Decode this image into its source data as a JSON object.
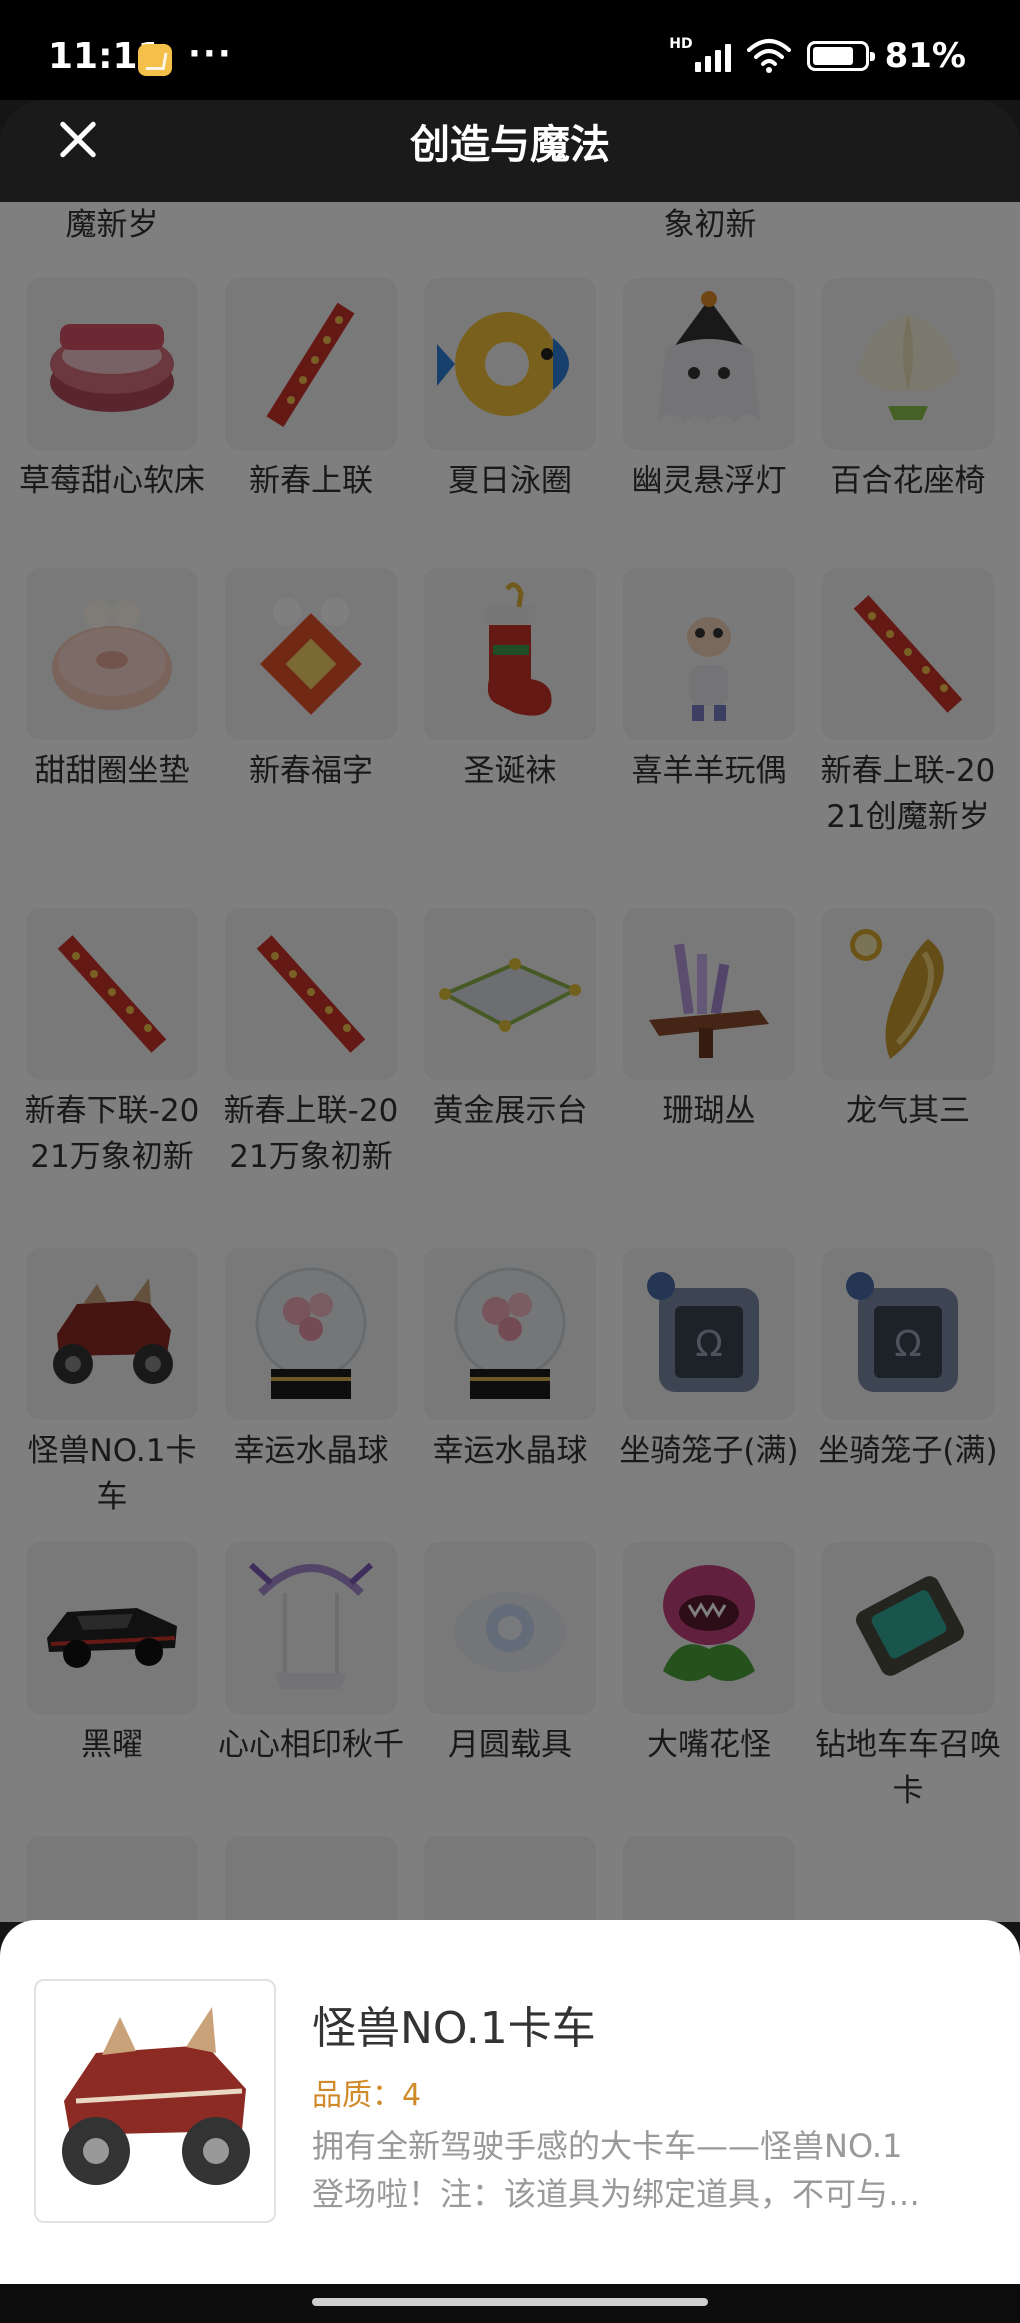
{
  "status_bar": {
    "time": "11:11",
    "more": "···",
    "network": "HD",
    "battery_pct": "81%"
  },
  "header": {
    "title": "创造与魔法"
  },
  "grid": {
    "top_partial_labels": [
      "魔新岁",
      "象初新"
    ],
    "items": [
      {
        "name": "草莓甜心软床",
        "icon": "strawberry-bed-icon"
      },
      {
        "name": "新春上联",
        "icon": "couplet-icon"
      },
      {
        "name": "夏日泳圈",
        "icon": "fish-swim-ring-icon"
      },
      {
        "name": "幽灵悬浮灯",
        "icon": "ghost-lamp-icon"
      },
      {
        "name": "百合花座椅",
        "icon": "lily-chair-icon"
      },
      {
        "name": "甜甜圈坐垫",
        "icon": "donut-cushion-icon"
      },
      {
        "name": "新春福字",
        "icon": "fu-character-icon"
      },
      {
        "name": "圣诞袜",
        "icon": "christmas-stocking-icon"
      },
      {
        "name": "喜羊羊玩偶",
        "icon": "sheep-doll-icon"
      },
      {
        "name": "新春上联-2021创魔新岁",
        "icon": "couplet-icon"
      },
      {
        "name": "新春下联-2021万象初新",
        "icon": "couplet-icon"
      },
      {
        "name": "新春上联-2021万象初新",
        "icon": "couplet-icon"
      },
      {
        "name": "黄金展示台",
        "icon": "display-stand-icon"
      },
      {
        "name": "珊瑚丛",
        "icon": "coral-icon"
      },
      {
        "name": "龙气其三",
        "icon": "dragon-relic-icon"
      },
      {
        "name": "怪兽NO.1卡车",
        "icon": "monster-truck-icon"
      },
      {
        "name": "幸运水晶球",
        "icon": "crystal-ball-icon"
      },
      {
        "name": "幸运水晶球",
        "icon": "crystal-ball-icon"
      },
      {
        "name": "坐骑笼子(满)",
        "icon": "mount-cage-icon"
      },
      {
        "name": "坐骑笼子(满)",
        "icon": "mount-cage-icon"
      },
      {
        "name": "黑曜",
        "icon": "black-car-icon"
      },
      {
        "name": "心心相印秋千",
        "icon": "swing-icon"
      },
      {
        "name": "月圆载具",
        "icon": "moon-vehicle-icon"
      },
      {
        "name": "大嘴花怪",
        "icon": "piranha-plant-icon"
      },
      {
        "name": "钻地车车召唤卡",
        "icon": "summon-card-icon"
      }
    ]
  },
  "sheet": {
    "title": "怪兽NO.1卡车",
    "quality": "品质：4",
    "desc_line1": "拥有全新驾驶手感的大卡车——怪兽NO.1",
    "desc_line2": "登场啦！注：该道具为绑定道具，不可与…",
    "image_icon": "monster-truck-icon"
  },
  "colors": {
    "quality": "#d08a2a",
    "desc": "#999999",
    "title": "#333333"
  }
}
